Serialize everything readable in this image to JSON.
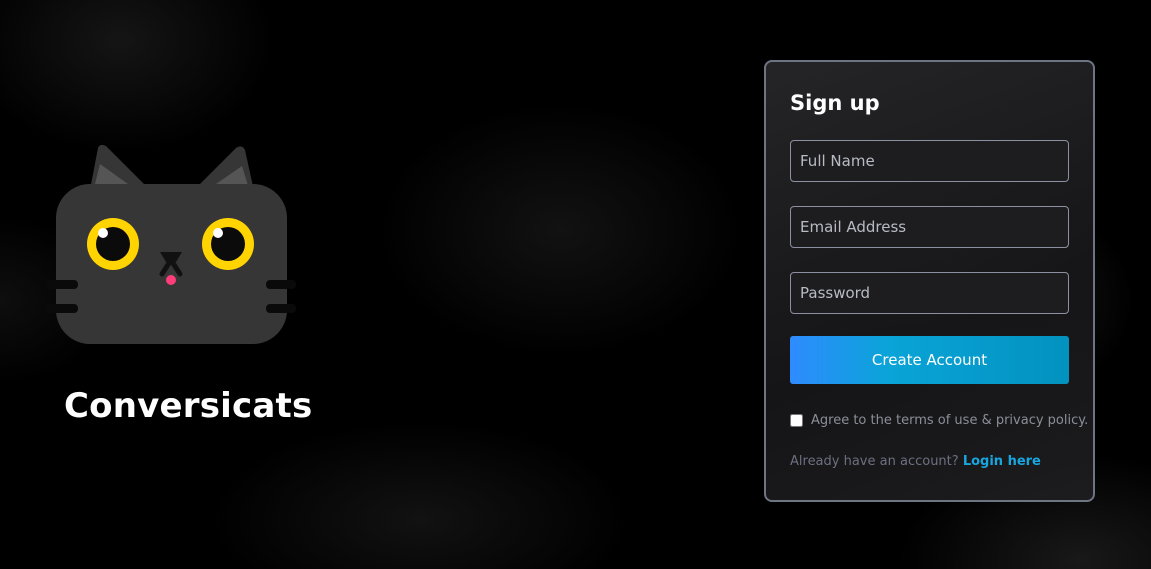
{
  "brand": {
    "name": "Conversicats",
    "colors": {
      "cat_body": "#363636",
      "cat_ear_inner": "#555555",
      "eye_ring": "#ffd400",
      "nose": "#111111",
      "tongue": "#ff3d7a"
    }
  },
  "signup": {
    "title": "Sign up",
    "fields": {
      "full_name": {
        "placeholder": "Full Name",
        "value": ""
      },
      "email": {
        "placeholder": "Email Address",
        "value": ""
      },
      "password": {
        "placeholder": "Password",
        "value": ""
      }
    },
    "submit_label": "Create Account",
    "terms": {
      "label": "Agree to the terms of use & privacy policy.",
      "checked": false
    },
    "login_prompt": "Already have an account?",
    "login_link": "Login here",
    "colors": {
      "card_border": "#6f7484",
      "button_gradient_start": "#2f8bff",
      "button_gradient_end": "#0292bf",
      "link": "#19a6e0"
    }
  }
}
